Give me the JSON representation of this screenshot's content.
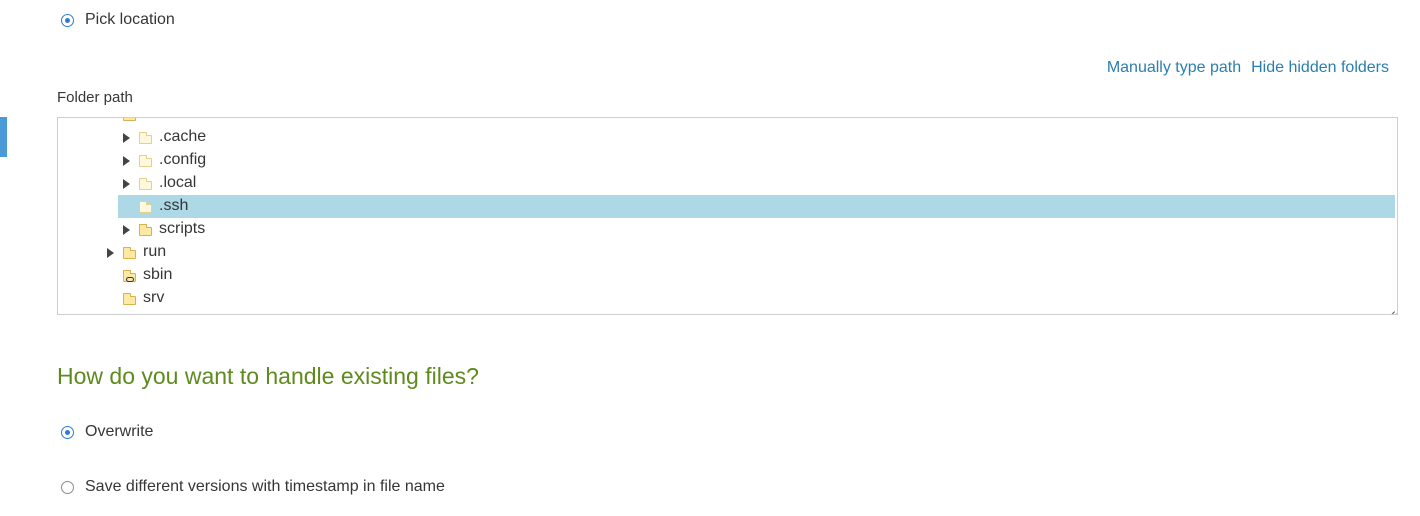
{
  "location": {
    "pick_label": "Pick location",
    "pick_selected": true
  },
  "links": {
    "manual_path": "Manually type path",
    "hide_hidden": "Hide hidden folders"
  },
  "folder_path": {
    "label": "Folder path",
    "tree": {
      "partial_top": "root",
      "items": [
        {
          "name": ".cache",
          "expandable": true,
          "hidden": true,
          "selected": false
        },
        {
          "name": ".config",
          "expandable": true,
          "hidden": true,
          "selected": false
        },
        {
          "name": ".local",
          "expandable": true,
          "hidden": true,
          "selected": false
        },
        {
          "name": ".ssh",
          "expandable": false,
          "hidden": true,
          "selected": true
        },
        {
          "name": "scripts",
          "expandable": true,
          "hidden": false,
          "selected": false
        },
        {
          "name": "run",
          "expandable": true,
          "hidden": false,
          "selected": false
        },
        {
          "name": "sbin",
          "expandable": false,
          "hidden": false,
          "selected": false,
          "symlink": true
        },
        {
          "name": "srv",
          "expandable": false,
          "hidden": false,
          "selected": false
        }
      ]
    }
  },
  "existing_files": {
    "heading": "How do you want to handle existing files?",
    "options": [
      {
        "label": "Overwrite",
        "selected": true
      },
      {
        "label": "Save different versions with timestamp in file name",
        "selected": false
      }
    ]
  },
  "colors": {
    "accent": "#2e7bd6",
    "link": "#2a7fae",
    "heading": "#5f8a1e",
    "selection": "#add8e6",
    "left_marker": "#4a9ad7"
  }
}
